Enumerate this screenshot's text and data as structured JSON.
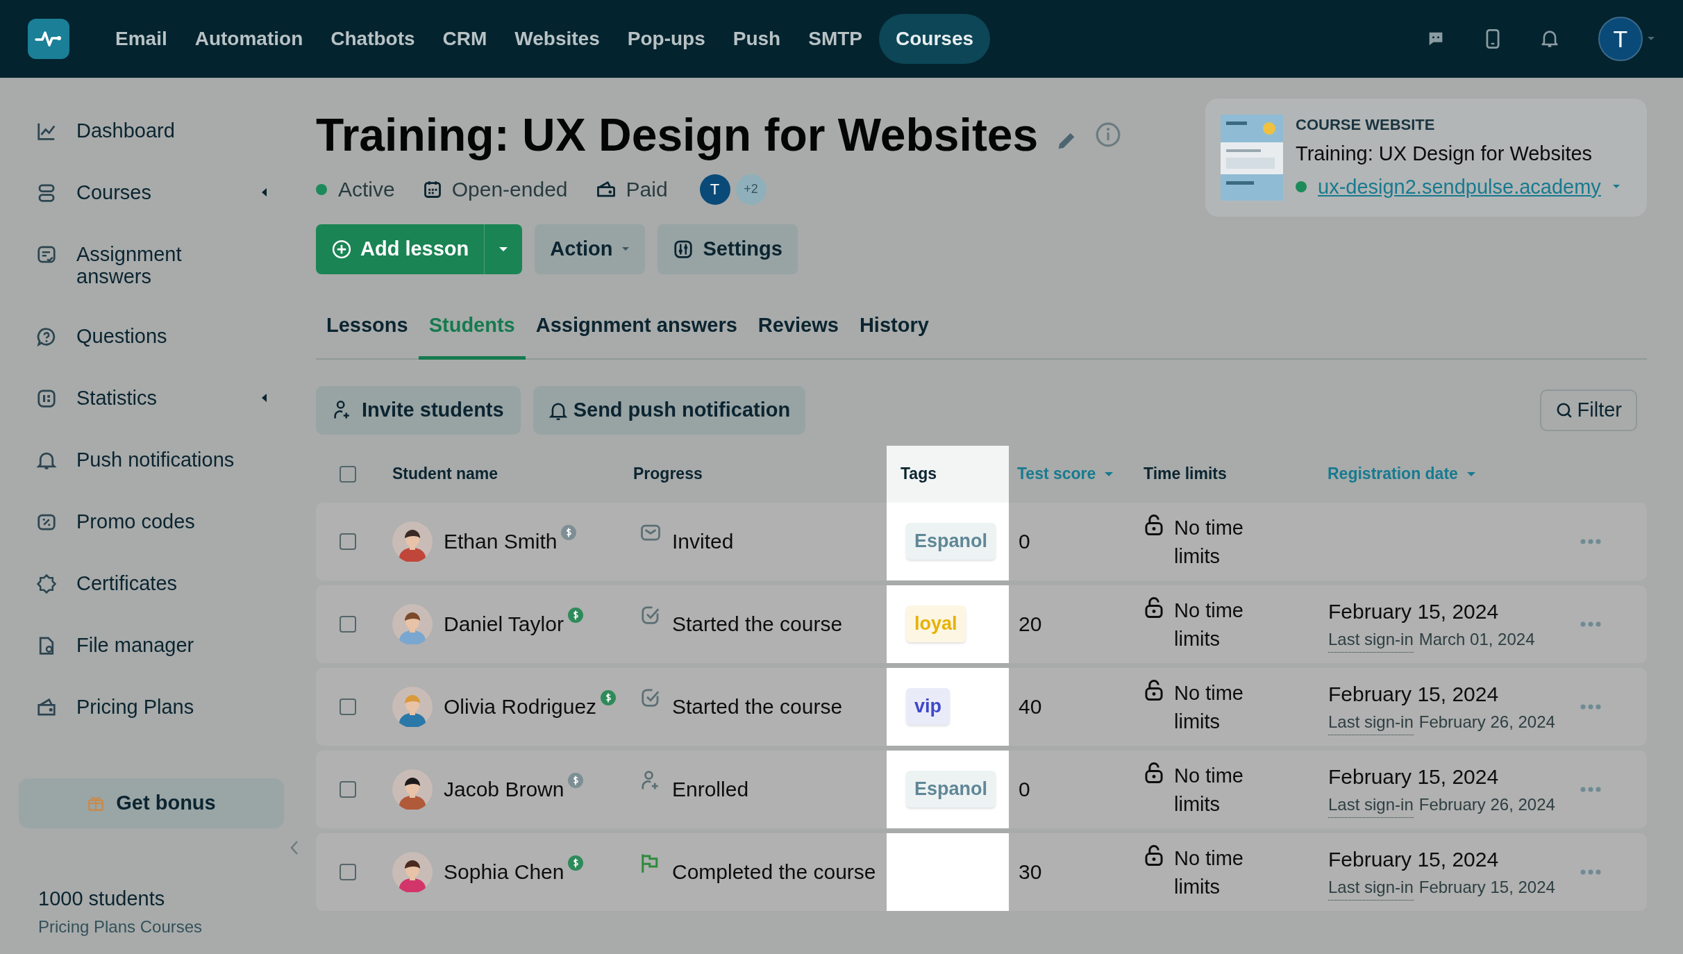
{
  "top_nav": {
    "items": [
      {
        "label": "Email",
        "selected": false
      },
      {
        "label": "Automation",
        "selected": false
      },
      {
        "label": "Chatbots",
        "selected": false
      },
      {
        "label": "CRM",
        "selected": false
      },
      {
        "label": "Websites",
        "selected": false
      },
      {
        "label": "Pop-ups",
        "selected": false
      },
      {
        "label": "Push",
        "selected": false
      },
      {
        "label": "SMTP",
        "selected": false
      },
      {
        "label": "Courses",
        "selected": true
      }
    ],
    "avatar": "T"
  },
  "sidebar": {
    "items": [
      {
        "label": "Dashboard",
        "has_submenu": false
      },
      {
        "label": "Courses",
        "has_submenu": true
      },
      {
        "label": "Assignment answers",
        "has_submenu": false
      },
      {
        "label": "Questions",
        "has_submenu": false
      },
      {
        "label": "Statistics",
        "has_submenu": true
      },
      {
        "label": "Push notifications",
        "has_submenu": false
      },
      {
        "label": "Promo codes",
        "has_submenu": false
      },
      {
        "label": "Certificates",
        "has_submenu": false
      },
      {
        "label": "File manager",
        "has_submenu": false
      },
      {
        "label": "Pricing Plans",
        "has_submenu": false
      }
    ],
    "bonus_button": "Get bonus",
    "students": "1000 students",
    "plan": "Pricing Plans Courses"
  },
  "course": {
    "title": "Training: UX Design for Websites",
    "status": "Active",
    "duration": "Open-ended",
    "pricing": "Paid",
    "team_avatar": "T",
    "team_more": "+2"
  },
  "actions": {
    "add_lesson": "Add lesson",
    "action": "Action",
    "settings": "Settings"
  },
  "website_card": {
    "heading": "COURSE WEBSITE",
    "title": "Training: UX Design for Websites",
    "url": "ux-design2.sendpulse.academy"
  },
  "tabs": [
    {
      "label": "Lessons",
      "selected": false
    },
    {
      "label": "Students",
      "selected": true
    },
    {
      "label": "Assignment answers",
      "selected": false
    },
    {
      "label": "Reviews",
      "selected": false
    },
    {
      "label": "History",
      "selected": false
    }
  ],
  "toolbar": {
    "invite": "Invite students",
    "push": "Send push notification",
    "filter": "Filter"
  },
  "table": {
    "select_all_checked": false,
    "columns": [
      {
        "label": "Student name",
        "sortable": false
      },
      {
        "label": "Progress",
        "sortable": false
      },
      {
        "label": "Tags",
        "sortable": false
      },
      {
        "label": "Test score",
        "sortable": true
      },
      {
        "label": "Time limits",
        "sortable": false
      },
      {
        "label": "Registration date",
        "sortable": true
      }
    ],
    "rows": [
      {
        "checked": false,
        "name": "Ethan Smith",
        "paid": false,
        "kind": "invited",
        "progress": "Invited",
        "tag": {
          "label": "Espanol",
          "color": "#5f8796"
        },
        "score": "0",
        "time_limit": "No time limits"
      },
      {
        "checked": false,
        "name": "Daniel Taylor",
        "paid": true,
        "kind": "started",
        "progress": "Started the course",
        "tag": {
          "label": "loyal",
          "color": "#e8b100"
        },
        "score": "20",
        "time_limit": "No time limits",
        "registered": "February 15, 2024",
        "last_sign_in_label": "Last sign-in",
        "last_sign_in": "March 01, 2024"
      },
      {
        "checked": false,
        "name": "Olivia Rodriguez",
        "paid": true,
        "kind": "started",
        "progress": "Started the course",
        "tag": {
          "label": "vip",
          "color": "#3d48c7"
        },
        "score": "40",
        "time_limit": "No time limits",
        "registered": "February 15, 2024",
        "last_sign_in_label": "Last sign-in",
        "last_sign_in": "February 26, 2024"
      },
      {
        "checked": false,
        "name": "Jacob Brown",
        "paid": false,
        "kind": "enrolled",
        "progress": "Enrolled",
        "tag": {
          "label": "Espanol",
          "color": "#5f8796"
        },
        "score": "0",
        "time_limit": "No time limits",
        "registered": "February 15, 2024",
        "last_sign_in_label": "Last sign-in",
        "last_sign_in": "February 26, 2024"
      },
      {
        "checked": false,
        "name": "Sophia Chen",
        "paid": true,
        "kind": "completed",
        "progress": "Completed the course",
        "score": "30",
        "time_limit": "No time limits",
        "registered": "February 15, 2024",
        "last_sign_in_label": "Last sign-in",
        "last_sign_in": "February 15, 2024"
      }
    ]
  }
}
